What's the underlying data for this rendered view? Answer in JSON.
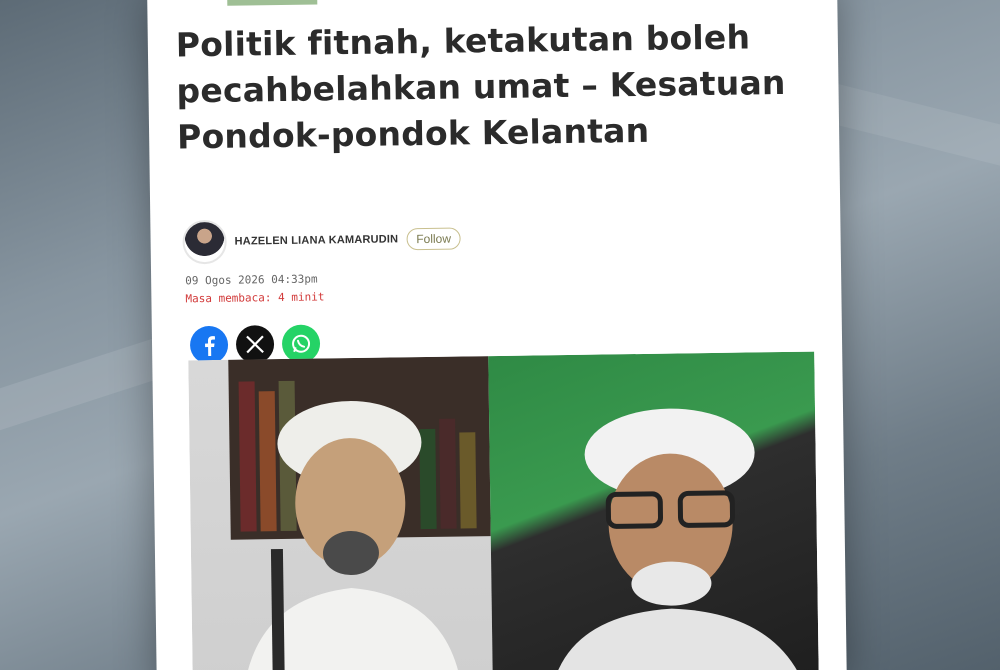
{
  "article": {
    "headline": "Politik fitnah, ketakutan boleh pecahbelahkan umat – Kesatuan Pondok-pondok Kelantan",
    "author_name": "HAZELEN LIANA KAMARUDIN",
    "follow_label": "Follow",
    "date": "09 Ogos 2026 04:33pm",
    "reading_time": "Masa membaca: 4 minit"
  },
  "share": {
    "facebook_icon": "facebook-icon",
    "x_icon": "x-icon",
    "whatsapp_icon": "whatsapp-icon"
  },
  "colors": {
    "facebook": "#1877f2",
    "x": "#111111",
    "whatsapp": "#25d366",
    "reading_time": "#d23b3b",
    "follow_border": "#c9c08f"
  }
}
